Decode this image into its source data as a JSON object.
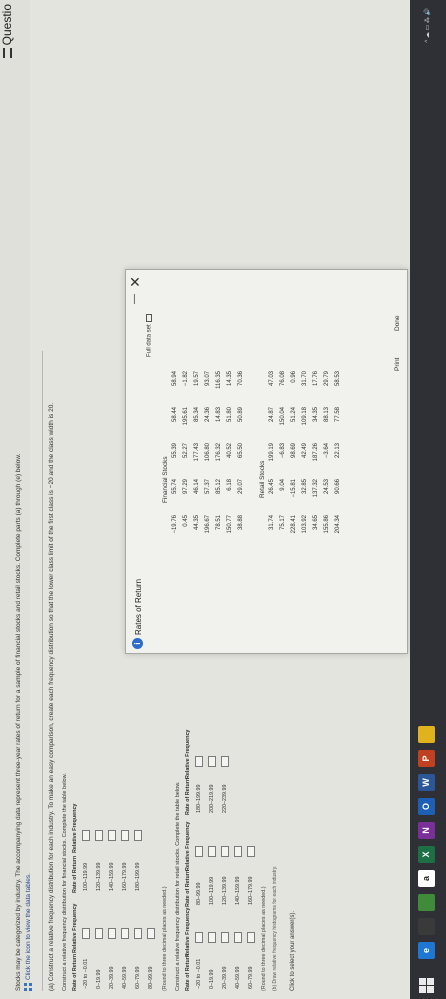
{
  "header": {
    "question_link": "Questio"
  },
  "intro": {
    "line1": "Stocks may be categorized by industry. The accompanying data represent three-year rates of return for a sample of financial stocks and retail stocks. Complete parts (a) through (e) below.",
    "line2": "Click the icon to view the data tables."
  },
  "part_a": "(a) Construct a relative frequency distribution for each industry. To make an easy comparison, create each frequency distribution so that the lower class limit of the first class is −20 and the class width is 20.",
  "financial_table": {
    "instruction": "Construct a relative frequency distribution for financial stocks. Complete the table below.",
    "headers": [
      "Rate of Return",
      "Relative Frequency",
      "Rate of Return",
      "Relative Frequency"
    ],
    "left_classes": [
      "−20 to −0.01",
      "0–19.99",
      "20–39.99",
      "40–59.99",
      "60–79.99",
      "80–99.99"
    ],
    "right_classes": [
      "100–119.99",
      "120–139.99",
      "140–159.99",
      "160–179.99",
      "180–199.99"
    ],
    "round_note": "(Round to three decimal places as needed.)"
  },
  "retail_table": {
    "instruction": "Construct a relative frequency distribution for retail stocks. Complete the table below.",
    "headers": [
      "Rate of Return",
      "Relative Frequency",
      "Rate of Return",
      "Relative Frequency",
      "Rate of Return",
      "Relative Frequency"
    ],
    "col1": [
      "−20 to −0.01",
      "0–19.99",
      "20–39.99",
      "40–59.99",
      "60–79.99"
    ],
    "col2": [
      "80–99.99",
      "100–119.99",
      "120–139.99",
      "140–159.99",
      "160–179.99"
    ],
    "col3": [
      "180–199.99",
      "200–219.99",
      "220–239.99"
    ],
    "round_note": "(Round to three decimal places as needed.)"
  },
  "cutoff_text": "(b) Draw relative frequency histograms for each industry.",
  "click_help": "Click to select your answer(s).",
  "dialog": {
    "title": "Rates of Return",
    "minimize": "—",
    "close": "✕",
    "full_data": "Full data set",
    "financial_title": "Financial Stocks",
    "financial_rows": [
      [
        "−19.76",
        "55.74",
        "55.39",
        "58.44",
        "58.94"
      ],
      [
        "0.45",
        "97.29",
        "52.27",
        "195.61",
        "−1.82"
      ],
      [
        "44.35",
        "46.14",
        "177.43",
        "85.34",
        "19.57"
      ],
      [
        "196.67",
        "57.37",
        "106.80",
        "24.36",
        "93.07"
      ],
      [
        "78.51",
        "85.12",
        "176.32",
        "14.83",
        "116.35"
      ],
      [
        "150.77",
        "6.18",
        "40.52",
        "51.80",
        "14.35"
      ],
      [
        "38.88",
        "29.07",
        "65.50",
        "50.89",
        "70.36"
      ]
    ],
    "retail_title": "Retail Stocks",
    "retail_rows": [
      [
        "31.74",
        "26.45",
        "199.19",
        "24.87",
        "47.03"
      ],
      [
        "75.17",
        "9.04",
        "−6.83",
        "150.04",
        "76.08"
      ],
      [
        "228.41",
        "−15.81",
        "98.69",
        "51.24",
        "0.96"
      ],
      [
        "103.92",
        "32.85",
        "42.49",
        "109.18",
        "31.70"
      ],
      [
        "34.65",
        "137.32",
        "187.26",
        "34.35",
        "17.76"
      ],
      [
        "155.86",
        "24.53",
        "−3.64",
        "88.13",
        "29.79"
      ],
      [
        "204.34",
        "90.66",
        "22.13",
        "77.58",
        "58.53"
      ]
    ],
    "print": "Print",
    "done": "Done"
  },
  "taskbar": {
    "icons": [
      {
        "name": "edge-icon",
        "label": "e",
        "color": "#1e77d2"
      },
      {
        "name": "store-icon",
        "label": "",
        "color": "#3a3a3a"
      },
      {
        "name": "mail-icon",
        "label": "",
        "color": "#3f8b3a"
      },
      {
        "name": "amazon-icon",
        "label": "a",
        "color": "#ffffff"
      },
      {
        "name": "excel-icon",
        "label": "X",
        "color": "#1d7044"
      },
      {
        "name": "onenote-icon",
        "label": "N",
        "color": "#7b2f9a"
      },
      {
        "name": "outlook-icon",
        "label": "O",
        "color": "#1d5fb5"
      },
      {
        "name": "word-icon",
        "label": "W",
        "color": "#2b579a"
      },
      {
        "name": "powerpoint-icon",
        "label": "P",
        "color": "#c1401f"
      },
      {
        "name": "chrome-icon",
        "label": "",
        "color": "#e0b21e"
      }
    ],
    "tray": "^ ☁ ▭ ⁂ 🔊"
  }
}
